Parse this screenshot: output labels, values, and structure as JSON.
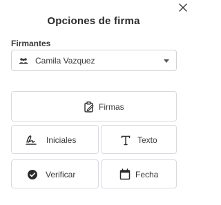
{
  "dialog": {
    "title": "Opciones de firma",
    "close_icon": "close-icon"
  },
  "signers": {
    "label": "Firmantes",
    "selected": "Camila Vazquez",
    "icon": "people-icon"
  },
  "actions": {
    "firmas": {
      "label": "Firmas",
      "icon": "signature-clipboard-icon"
    },
    "iniciales": {
      "label": "Iniciales",
      "icon": "initials-signature-icon"
    },
    "texto": {
      "label": "Texto",
      "icon": "text-icon"
    },
    "verificar": {
      "label": "Verificar",
      "icon": "check-circle-icon"
    },
    "fecha": {
      "label": "Fecha",
      "icon": "calendar-icon"
    }
  },
  "colors": {
    "text": "#2b2b2b",
    "border": "#d7dbe1",
    "icon": "#2b2b2b"
  }
}
